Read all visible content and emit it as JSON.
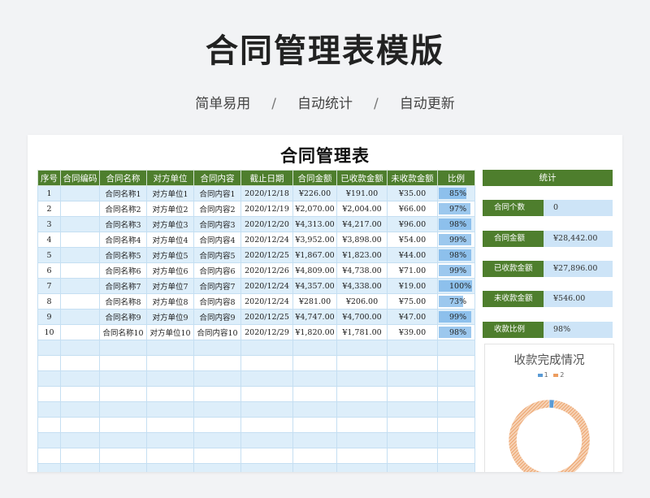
{
  "hero": {
    "title": "合同管理表模版",
    "tags": [
      "简单易用",
      "自动统计",
      "自动更新"
    ],
    "separator": "/"
  },
  "sheet": {
    "title": "合同管理表",
    "columns": [
      "序号",
      "合同编码",
      "合同名称",
      "对方单位",
      "合同内容",
      "截止日期",
      "合同金额",
      "已收款金额",
      "未收款金额",
      "比例"
    ],
    "rows": [
      {
        "no": "1",
        "code": "",
        "name": "合同名称1",
        "party": "对方单位1",
        "content": "合同内容1",
        "date": "2020/12/18",
        "amount": "¥226.00",
        "received": "¥191.00",
        "unreceived": "¥35.00",
        "ratio_text": "85%",
        "ratio": 0.85
      },
      {
        "no": "2",
        "code": "",
        "name": "合同名称2",
        "party": "对方单位2",
        "content": "合同内容2",
        "date": "2020/12/19",
        "amount": "¥2,070.00",
        "received": "¥2,004.00",
        "unreceived": "¥66.00",
        "ratio_text": "97%",
        "ratio": 0.97
      },
      {
        "no": "3",
        "code": "",
        "name": "合同名称3",
        "party": "对方单位3",
        "content": "合同内容3",
        "date": "2020/12/20",
        "amount": "¥4,313.00",
        "received": "¥4,217.00",
        "unreceived": "¥96.00",
        "ratio_text": "98%",
        "ratio": 0.98
      },
      {
        "no": "4",
        "code": "",
        "name": "合同名称4",
        "party": "对方单位4",
        "content": "合同内容4",
        "date": "2020/12/24",
        "amount": "¥3,952.00",
        "received": "¥3,898.00",
        "unreceived": "¥54.00",
        "ratio_text": "99%",
        "ratio": 0.99
      },
      {
        "no": "5",
        "code": "",
        "name": "合同名称5",
        "party": "对方单位5",
        "content": "合同内容5",
        "date": "2020/12/25",
        "amount": "¥1,867.00",
        "received": "¥1,823.00",
        "unreceived": "¥44.00",
        "ratio_text": "98%",
        "ratio": 0.98
      },
      {
        "no": "6",
        "code": "",
        "name": "合同名称6",
        "party": "对方单位6",
        "content": "合同内容6",
        "date": "2020/12/26",
        "amount": "¥4,809.00",
        "received": "¥4,738.00",
        "unreceived": "¥71.00",
        "ratio_text": "99%",
        "ratio": 0.99
      },
      {
        "no": "7",
        "code": "",
        "name": "合同名称7",
        "party": "对方单位7",
        "content": "合同内容7",
        "date": "2020/12/24",
        "amount": "¥4,357.00",
        "received": "¥4,338.00",
        "unreceived": "¥19.00",
        "ratio_text": "100%",
        "ratio": 1.0
      },
      {
        "no": "8",
        "code": "",
        "name": "合同名称8",
        "party": "对方单位8",
        "content": "合同内容8",
        "date": "2020/12/24",
        "amount": "¥281.00",
        "received": "¥206.00",
        "unreceived": "¥75.00",
        "ratio_text": "73%",
        "ratio": 0.73
      },
      {
        "no": "9",
        "code": "",
        "name": "合同名称9",
        "party": "对方单位9",
        "content": "合同内容9",
        "date": "2020/12/25",
        "amount": "¥4,747.00",
        "received": "¥4,700.00",
        "unreceived": "¥47.00",
        "ratio_text": "99%",
        "ratio": 0.99
      },
      {
        "no": "10",
        "code": "",
        "name": "合同名称10",
        "party": "对方单位10",
        "content": "合同内容10",
        "date": "2020/12/29",
        "amount": "¥1,820.00",
        "received": "¥1,781.00",
        "unreceived": "¥39.00",
        "ratio_text": "98%",
        "ratio": 0.98
      }
    ],
    "empty_rows": 9
  },
  "stats": {
    "header": "统计",
    "items": [
      {
        "label": "合同个数",
        "value": "0"
      },
      {
        "label": "合同金额",
        "value": "¥28,442.00"
      },
      {
        "label": "已收款金额",
        "value": "¥27,896.00"
      },
      {
        "label": "未收款金额",
        "value": "¥546.00"
      },
      {
        "label": "收款比例",
        "value": "98%"
      }
    ]
  },
  "chart_data": {
    "type": "pie",
    "title": "收款完成情况",
    "legend": [
      "1",
      "2"
    ],
    "values": [
      2,
      98
    ],
    "colors": [
      "#5b9bd5",
      "#ed9d5f"
    ]
  }
}
